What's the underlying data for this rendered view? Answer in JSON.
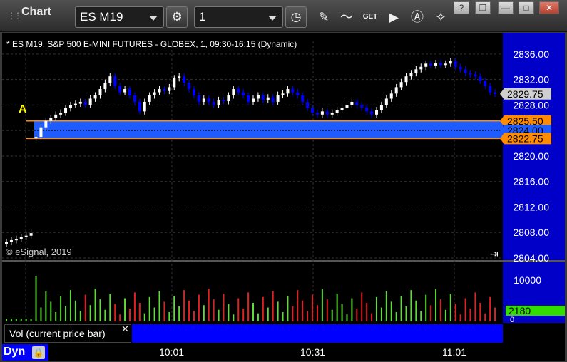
{
  "toolbar": {
    "title": "Chart",
    "symbol": "ES M19",
    "interval": "1",
    "icons": [
      "gear-icon",
      "clock-icon",
      "pencil-icon",
      "studies-icon",
      "get-icon",
      "play-icon",
      "alert-icon",
      "pin-icon"
    ]
  },
  "window_buttons": [
    "?",
    "❐",
    "—",
    "□",
    "✕"
  ],
  "caption": "* ES M19, S&P 500 E-MINI FUTURES - GLOBEX, 1, 09:30-16:15 (Dynamic)",
  "copyright": "© eSignal, 2019",
  "marker_label": "A",
  "price_axis": [
    "2836.00",
    "2832.00",
    "2828.00",
    "2824.00",
    "2820.00",
    "2816.00",
    "2812.00",
    "2808.00",
    "2804.00"
  ],
  "price_tags": {
    "last": "2829.75",
    "upper": "2825.50",
    "middle": "2824.00",
    "lower": "2822.75"
  },
  "volume_axis": [
    "10000",
    "0"
  ],
  "volume_tag": "2180",
  "volume_label": "Vol (current price bar)",
  "time_labels": [
    "10:01",
    "10:31",
    "11:01"
  ],
  "mode": "Dyn",
  "colors": {
    "up": "#ffffff",
    "down": "#0000ff",
    "zone": "#1e5cff",
    "zone_edge": "#ff8c00",
    "axis_bg": "#0000c8",
    "vol_up": "#5fdc3a",
    "vol_down": "#e02020",
    "vol_tag": "#33dd00"
  },
  "chart_data": [
    {
      "type": "candlestick",
      "symbol": "ES M19",
      "ylim": [
        2804,
        2838
      ],
      "zone": {
        "top": 2825.5,
        "bottom": 2822.75,
        "mid": 2824.0
      },
      "last": 2829.75,
      "close": [
        2806.5,
        2806.8,
        2807.0,
        2807.3,
        2807.5,
        2807.9,
        2823.0,
        2824.5,
        2825.5,
        2826.0,
        2826.5,
        2826.8,
        2827.5,
        2828.0,
        2828.2,
        2828.5,
        2828.0,
        2829.0,
        2829.5,
        2830.5,
        2831.5,
        2832.5,
        2831.0,
        2830.0,
        2830.5,
        2829.5,
        2828.5,
        2827.0,
        2828.5,
        2829.5,
        2830.0,
        2830.5,
        2830.2,
        2830.8,
        2832.2,
        2832.5,
        2831.5,
        2830.5,
        2829.5,
        2828.5,
        2829.0,
        2828.5,
        2828.0,
        2828.8,
        2828.6,
        2829.5,
        2830.5,
        2830.0,
        2829.5,
        2828.5,
        2829.0,
        2829.5,
        2828.8,
        2829.2,
        2828.5,
        2829.6,
        2829.8,
        2830.5,
        2830.0,
        2829.5,
        2828.5,
        2827.5,
        2826.8,
        2826.5,
        2827.0,
        2826.5,
        2826.8,
        2827.2,
        2827.6,
        2828.0,
        2828.5,
        2828.0,
        2827.6,
        2827.0,
        2826.5,
        2827.2,
        2828.0,
        2829.0,
        2829.8,
        2830.8,
        2831.6,
        2832.5,
        2833.0,
        2833.6,
        2834.0,
        2834.5,
        2834.2,
        2834.6,
        2834.3,
        2834.5,
        2834.9,
        2834.0,
        2833.6,
        2833.0,
        2832.8,
        2832.5,
        2831.8,
        2831.0,
        2830.0,
        2829.75
      ],
      "volume_axis_max": 10000
    }
  ]
}
